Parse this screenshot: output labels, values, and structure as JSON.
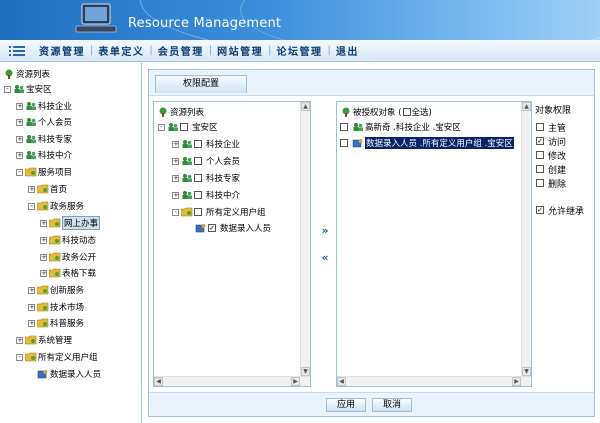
{
  "header": {
    "title": "Resource Management"
  },
  "menu": [
    "资源管理",
    "表单定义",
    "会员管理",
    "网站管理",
    "论坛管理",
    "退出"
  ],
  "left_tree": {
    "root_label": "资源列表",
    "items": [
      {
        "label": "宝安区",
        "level": 0,
        "expander": "-"
      },
      {
        "label": "科技企业",
        "level": 1,
        "expander": "+"
      },
      {
        "label": "个人会员",
        "level": 1,
        "expander": "+"
      },
      {
        "label": "科技专家",
        "level": 1,
        "expander": "+"
      },
      {
        "label": "科技中介",
        "level": 1,
        "expander": "+"
      },
      {
        "label": "服务项目",
        "level": 1,
        "expander": "-"
      },
      {
        "label": "首页",
        "level": 2,
        "expander": "+"
      },
      {
        "label": "政务服务",
        "level": 2,
        "expander": "-"
      },
      {
        "label": "网上办事",
        "level": 3,
        "expander": "+",
        "highlight": true
      },
      {
        "label": "科技动态",
        "level": 3,
        "expander": "+"
      },
      {
        "label": "政务公开",
        "level": 3,
        "expander": "+"
      },
      {
        "label": "表格下载",
        "level": 3,
        "expander": "+"
      },
      {
        "label": "创新服务",
        "level": 2,
        "expander": "+"
      },
      {
        "label": "技术市场",
        "level": 2,
        "expander": "+"
      },
      {
        "label": "科普服务",
        "level": 2,
        "expander": "+"
      },
      {
        "label": "系统管理",
        "level": 1,
        "expander": "+"
      },
      {
        "label": "所有定义用户组",
        "level": 1,
        "expander": "-"
      },
      {
        "label": "数据录入人员",
        "level": 2,
        "expander": ""
      }
    ]
  },
  "panel": {
    "tab_label": "权限配置",
    "resource_tree": {
      "root_label": "资源列表",
      "items": [
        {
          "label": "宝安区",
          "level": 0,
          "expander": "-",
          "checked": false
        },
        {
          "label": "科技企业",
          "level": 1,
          "expander": "+",
          "checked": false
        },
        {
          "label": "个人会员",
          "level": 1,
          "expander": "+",
          "checked": false
        },
        {
          "label": "科技专家",
          "level": 1,
          "expander": "+",
          "checked": false
        },
        {
          "label": "科技中介",
          "level": 1,
          "expander": "+",
          "checked": false
        },
        {
          "label": "所有定义用户组",
          "level": 1,
          "expander": "-",
          "checked": false
        },
        {
          "label": "数据录入人员",
          "level": 2,
          "expander": "",
          "checked": true
        }
      ]
    },
    "add_arrow": "»",
    "remove_arrow": "«",
    "authorized": {
      "header": "被授权对象 (",
      "header_selectall": "全选)",
      "items": [
        {
          "label": "高新奇 .科技企业 .宝安区",
          "selected": false
        },
        {
          "label": "数据录入人员 .所有定义用户组 .宝安区",
          "selected": true
        }
      ]
    },
    "permissions": {
      "title": "对象权限",
      "items": [
        {
          "label": "主管",
          "checked": false
        },
        {
          "label": "访问",
          "checked": true
        },
        {
          "label": "修改",
          "checked": false
        },
        {
          "label": "创建",
          "checked": false
        },
        {
          "label": "删除",
          "checked": false
        }
      ],
      "inherit": {
        "label": "允许继承",
        "checked": true
      }
    },
    "apply_label": "应用",
    "cancel_label": "取消"
  }
}
